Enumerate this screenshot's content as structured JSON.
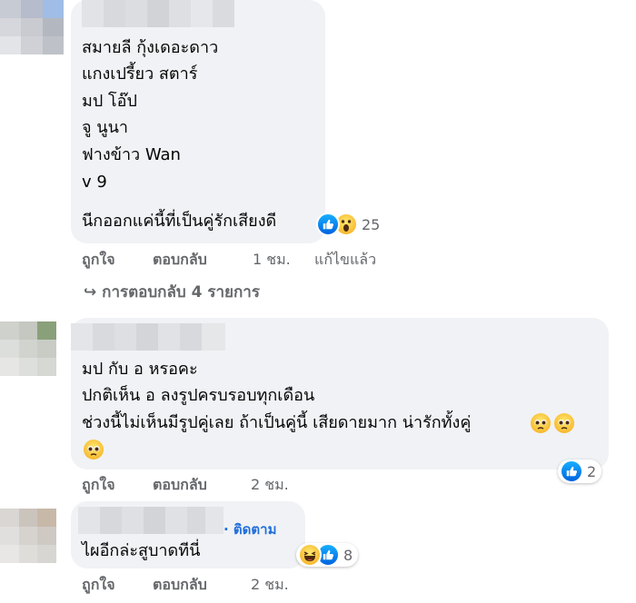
{
  "comments": [
    {
      "lines": [
        "สมายลี กุ้งเดอะดาว",
        "แกงเปรี้ยว สตาร์",
        "มป โอ๊ป",
        "จู นูนา",
        "ฟางข้าว Wan",
        "v 9",
        "นีกออกแค่นี้ที่เป็นคู่รักเสียงดี"
      ],
      "reaction_icons": [
        "like-icon",
        "wow-icon"
      ],
      "reaction_count": "25",
      "actions": {
        "like": "ถูกใจ",
        "reply": "ตอบกลับ",
        "time": "1 ชม.",
        "edited": "แก้ไขแล้ว"
      },
      "replies_link": "↪ การตอบกลับ 4 รายการ"
    },
    {
      "lines": [
        "มป กับ อ หรอคะ",
        "ปกติเห็น อ ลงรูปครบรอบทุกเดือน",
        "ช่วงนี้ไม่เห็นมีรูปคู่เลย ถ้าเป็นคู่นี้ เสียดายมาก น่ารักทั้งคู่"
      ],
      "reaction_icons": [
        "like-icon"
      ],
      "reaction_count": "2",
      "actions": {
        "like": "ถูกใจ",
        "reply": "ตอบกลับ",
        "time": "2 ชม."
      }
    },
    {
      "follow": "· ติดตาม",
      "lines": [
        "ไผอีกล่ะสูบาดทีนี่"
      ],
      "reaction_icons": [
        "haha-icon",
        "like-icon"
      ],
      "reaction_count": "8",
      "actions": {
        "like": "ถูกใจ",
        "reply": "ตอบกลับ",
        "time": "2 ชม."
      }
    }
  ],
  "colors": {
    "bubble": "#f0f2f5",
    "meta_text": "#65676b",
    "link_blue": "#216fdb",
    "like_blue": "#1877f2"
  }
}
